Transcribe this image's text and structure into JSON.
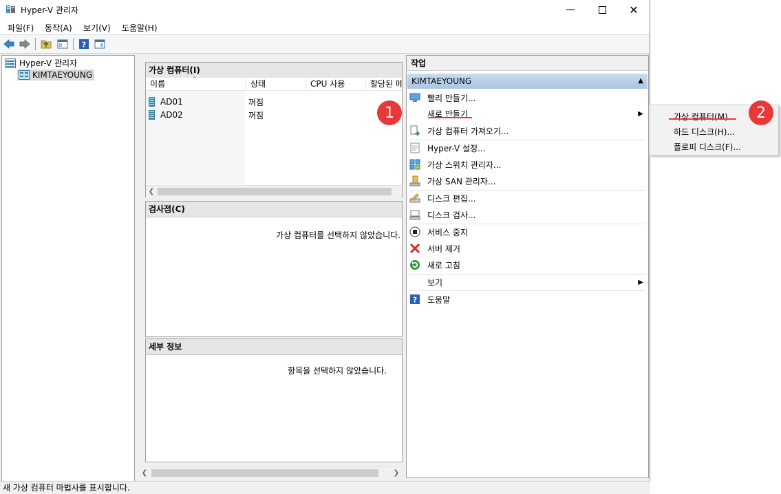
{
  "window": {
    "title": "Hyper-V 관리자"
  },
  "menu": {
    "items": [
      "파일(F)",
      "동작(A)",
      "보기(V)",
      "도움말(H)"
    ]
  },
  "tree": {
    "root": "Hyper-V 관리자",
    "server": "KIMTAEYOUNG"
  },
  "vms": {
    "header": "가상 컴퓨터(I)",
    "columns": [
      "이름",
      "상태",
      "CPU 사용",
      "할당된 메"
    ],
    "rows": [
      {
        "name": "AD01",
        "state": "꺼짐"
      },
      {
        "name": "AD02",
        "state": "꺼짐"
      }
    ]
  },
  "checkpoints": {
    "header": "검사점(C)",
    "empty": "가상 컴퓨터를 선택하지 않았습니다."
  },
  "details": {
    "header": "세부 정보",
    "empty": "항목을 선택하지 않았습니다."
  },
  "actions": {
    "header": "작업",
    "group": "KIMTAEYOUNG",
    "items": [
      {
        "label": "빨리 만들기...",
        "icon": "quick-create-icon"
      },
      {
        "label": "새로 만들기",
        "icon": "none",
        "submenu": true
      },
      {
        "label": "가상 컴퓨터 가져오기...",
        "icon": "import-vm-icon"
      },
      {
        "label": "Hyper-V 설정...",
        "icon": "settings-icon"
      },
      {
        "label": "가상 스위치 관리자...",
        "icon": "switch-icon"
      },
      {
        "label": "가상 SAN 관리자...",
        "icon": "san-icon"
      },
      {
        "label": "디스크 편집...",
        "icon": "edit-disk-icon"
      },
      {
        "label": "디스크 검사...",
        "icon": "inspect-disk-icon"
      },
      {
        "label": "서비스 중지",
        "icon": "stop-icon"
      },
      {
        "label": "서버 제거",
        "icon": "remove-icon"
      },
      {
        "label": "새로 고침",
        "icon": "refresh-icon"
      },
      {
        "label": "보기",
        "icon": "none",
        "submenu": true
      },
      {
        "label": "도움말",
        "icon": "help-icon"
      }
    ]
  },
  "submenu": {
    "items": [
      "가상 컴퓨터(M)...",
      "하드 디스크(H)...",
      "플로피 디스크(F)..."
    ]
  },
  "badges": {
    "one": "1",
    "two": "2"
  },
  "status": {
    "text": "새 가상 컴퓨터 마법사를 표시합니다."
  },
  "colors": {
    "badge": "#e8393a",
    "group_header": "#b8d1ea"
  }
}
